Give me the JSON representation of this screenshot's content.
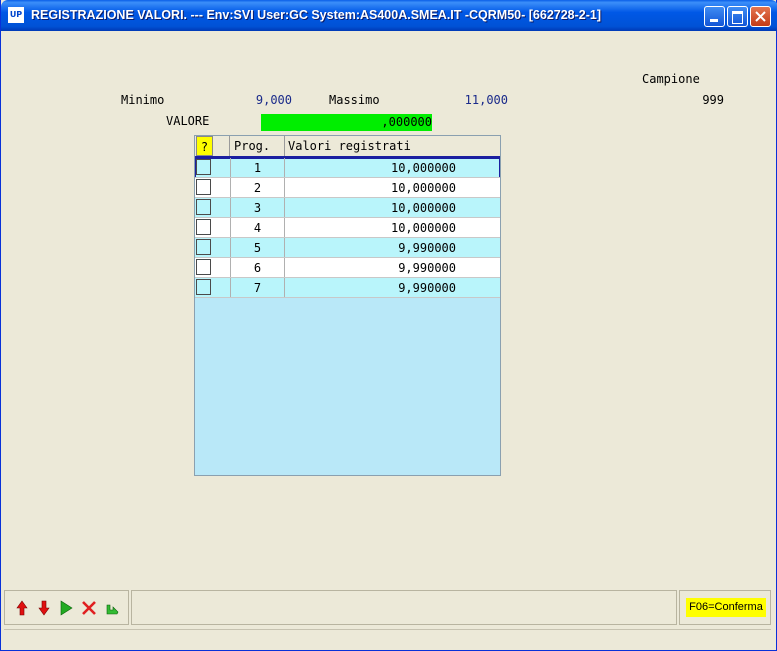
{
  "window": {
    "icon_text": "UP",
    "title": "REGISTRAZIONE VALORI. --- Env:SVI User:GC System:AS400A.SMEA.IT -CQRM50- [662728-2-1]"
  },
  "header": {
    "minimo_label": "Minimo",
    "minimo_value": "9,000",
    "massimo_label": "Massimo",
    "massimo_value": "11,000",
    "campione_label": "Campione",
    "campione_value": "999",
    "valore_label": "VALORE",
    "valore_value": ",000000"
  },
  "grid": {
    "help_label": "?",
    "columns": [
      "Prog.",
      "Valori registrati"
    ],
    "rows": [
      {
        "prog": "1",
        "value": "10,000000"
      },
      {
        "prog": "2",
        "value": "10,000000"
      },
      {
        "prog": "3",
        "value": "10,000000"
      },
      {
        "prog": "4",
        "value": "10,000000"
      },
      {
        "prog": "5",
        "value": "9,990000"
      },
      {
        "prog": "6",
        "value": "9,990000"
      },
      {
        "prog": "7",
        "value": "9,990000"
      }
    ]
  },
  "toolbar": {
    "icons": [
      "arrow-up-icon",
      "arrow-down-icon",
      "play-icon",
      "cancel-x-icon",
      "return-icon"
    ],
    "f06_label": "F06=Conferma"
  },
  "colors": {
    "valore_field": "#00ee00",
    "help_button": "#ffff00",
    "grid_background": "#b9e8f8",
    "row_odd": "#b9f5fb",
    "value_text": "#1a2a8a"
  }
}
